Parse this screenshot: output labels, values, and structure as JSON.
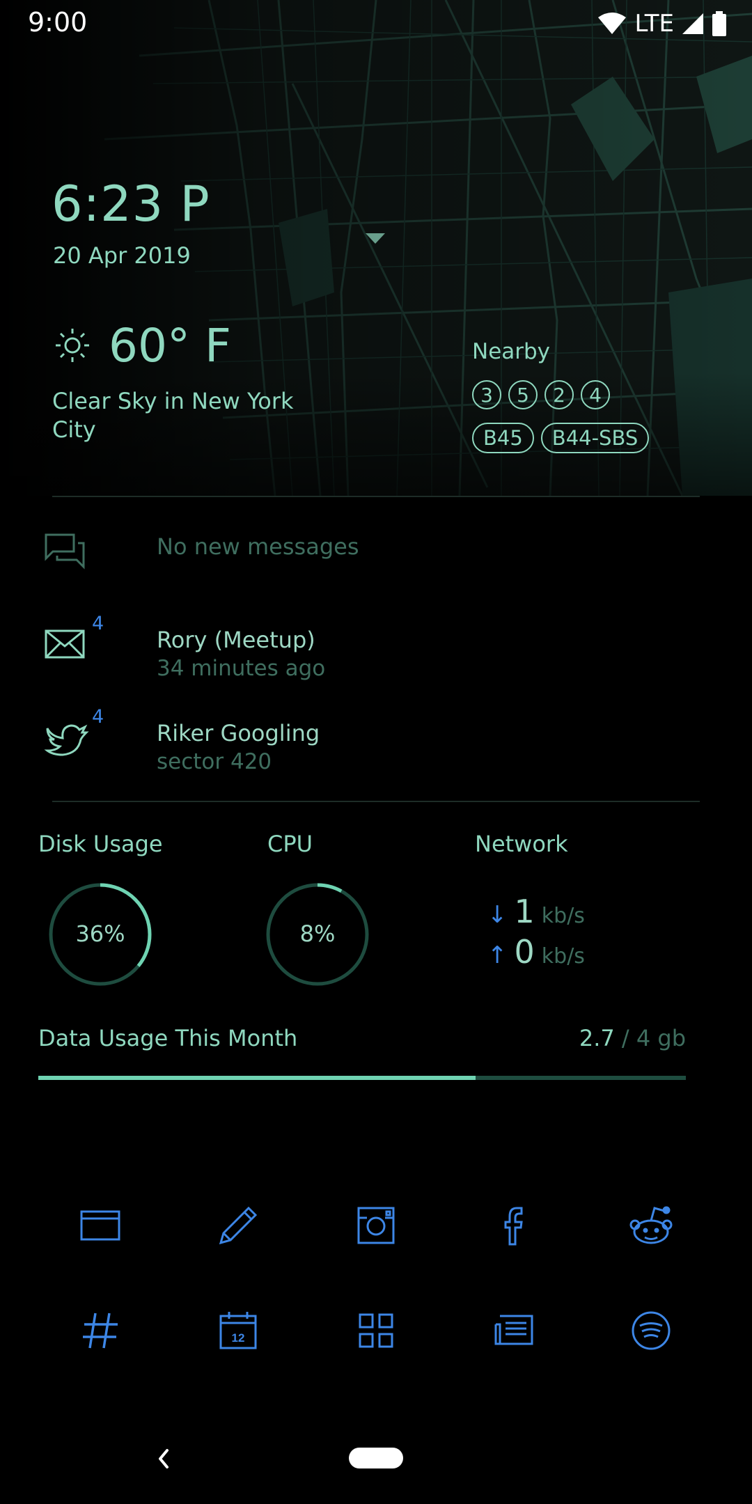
{
  "status_bar": {
    "time": "9:00",
    "network": "LTE",
    "icons": [
      "wifi-icon",
      "cell-signal-icon",
      "battery-icon"
    ]
  },
  "clock": {
    "time": "6:23 P",
    "date": "20 Apr 2019"
  },
  "weather": {
    "icon": "sun-icon",
    "temperature": "60° F",
    "conditions": "Clear Sky in New York City"
  },
  "nearby": {
    "label": "Nearby",
    "routes_circle": [
      "3",
      "5",
      "2",
      "4"
    ],
    "routes_pill": [
      "B45",
      "B44-SBS"
    ]
  },
  "notifications": [
    {
      "icon": "chat-icon",
      "title": "No new messages",
      "subtitle": "",
      "badge": ""
    },
    {
      "icon": "mail-icon",
      "title": "Rory (Meetup)",
      "subtitle": "34 minutes ago",
      "badge": "4"
    },
    {
      "icon": "twitter-icon",
      "title": "Riker Googling",
      "subtitle": "sector 420",
      "badge": "4"
    }
  ],
  "system": {
    "disk": {
      "label": "Disk Usage",
      "value_text": "36%",
      "fraction": 0.36
    },
    "cpu": {
      "label": "CPU",
      "value_text": "8%",
      "fraction": 0.08
    },
    "network": {
      "label": "Network",
      "down_value": "1",
      "down_unit": "kb/s",
      "up_value": "0",
      "up_unit": "kb/s"
    }
  },
  "data_usage": {
    "label": "Data Usage This Month",
    "used": "2.7",
    "total": "/ 4 gb",
    "fraction": 0.675
  },
  "apps": [
    [
      "browser-icon",
      "pencil-icon",
      "instagram-icon",
      "facebook-icon",
      "reddit-icon"
    ],
    [
      "slack-hashtag-icon",
      "calendar-icon",
      "app-grid-icon",
      "news-icon",
      "spotify-icon"
    ]
  ],
  "calendar_day": "12",
  "colors": {
    "accent": "#8fd8bf",
    "muted": "#3f6e5f",
    "blue": "#3d86e6",
    "background": "#000000"
  }
}
